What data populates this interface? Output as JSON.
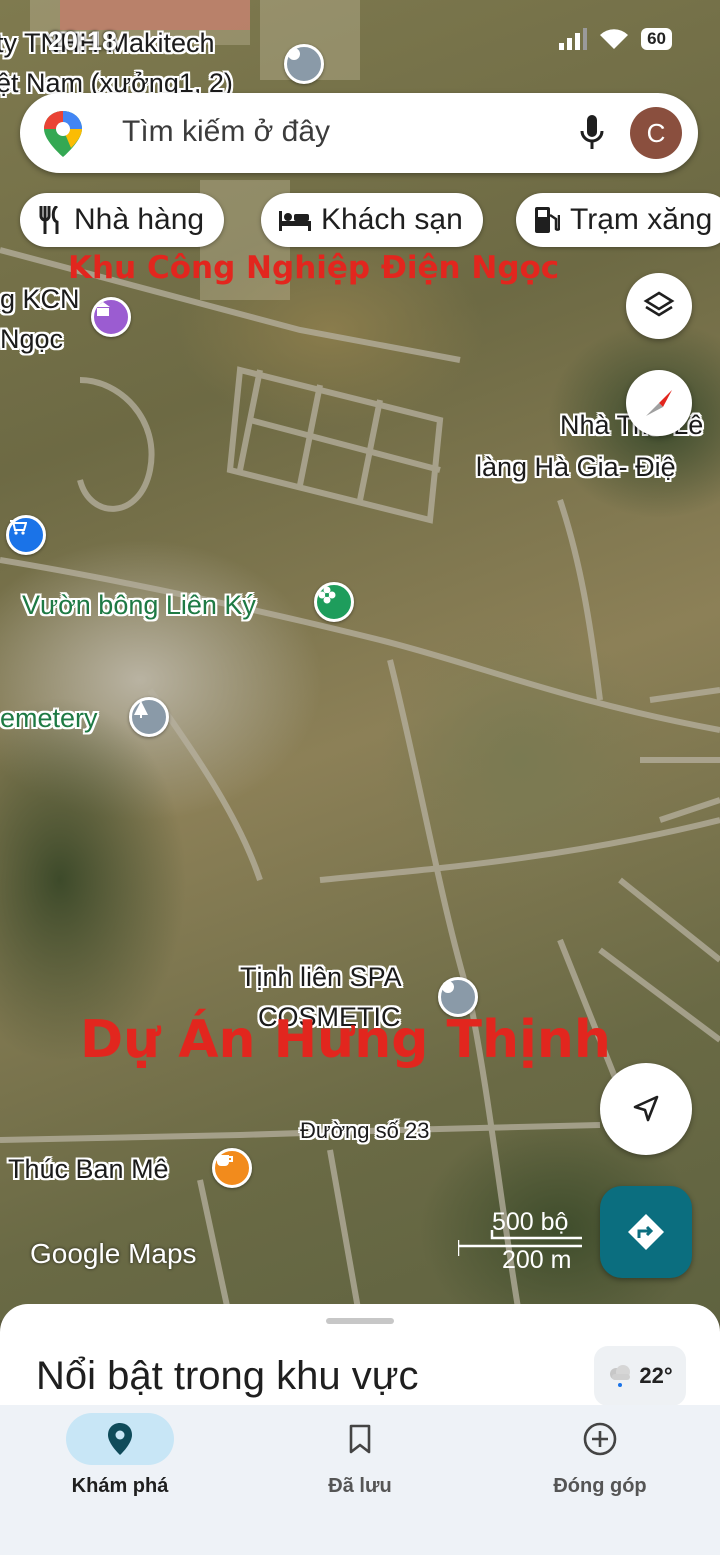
{
  "status_bar": {
    "time": "20:18",
    "battery": "60"
  },
  "search": {
    "placeholder": "Tìm kiếm ở đây",
    "avatar_letter": "C"
  },
  "chips": [
    {
      "label": "Nhà hàng",
      "icon": "restaurant-icon"
    },
    {
      "label": "Khách sạn",
      "icon": "hotel-icon"
    },
    {
      "label": "Trạm xăng",
      "icon": "gas-station-icon"
    }
  ],
  "map": {
    "labels": {
      "makitech_line1": "ty TNHH Makitech",
      "makitech_line2": "ệt Nam (xưởng1, 2)",
      "kcn_line1": "g KCN",
      "kcn_line2": "Ngọc",
      "nha_tho_line1": "Nhà Thờ Lê",
      "nha_tho_line2": "làng Hà Gia- Điệ",
      "vuon_bong": "Vườn bông Liên Ký",
      "cemetery": "emetery",
      "spa_line1": "Tịnh liên SPA",
      "spa_line2": "COSMETIC",
      "road": "Đường số 23",
      "cafe": "Thúc Ban Mê"
    },
    "overlays": {
      "industrial_zone": "Khu Công Nghiệp Điện Ngọc",
      "project": "Dự Án Hưng Thịnh"
    },
    "scale": {
      "imperial": "500 bộ",
      "metric": "200 m"
    },
    "attribution": "Google Maps"
  },
  "sheet": {
    "title": "Nổi bật trong khu vực",
    "temperature": "22°"
  },
  "nav": [
    {
      "label": "Khám phá",
      "active": true
    },
    {
      "label": "Đã lưu",
      "active": false
    },
    {
      "label": "Đóng góp",
      "active": false
    }
  ],
  "colors": {
    "accent": "#0b6e7f",
    "overlay_red": "#e2261e",
    "poi_green": "#1e7a44",
    "poi_purple": "#9b5cd1",
    "poi_blue": "#1a73e8",
    "poi_orange": "#f28b1c"
  }
}
